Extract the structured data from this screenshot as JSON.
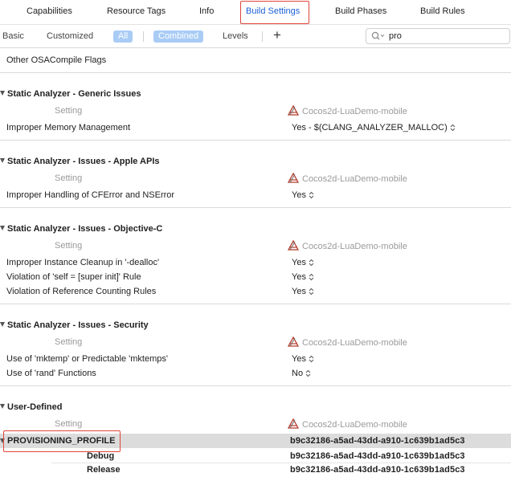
{
  "tabs": [
    {
      "label": "Capabilities"
    },
    {
      "label": "Resource Tags"
    },
    {
      "label": "Info"
    },
    {
      "label": "Build Settings"
    },
    {
      "label": "Build Phases"
    },
    {
      "label": "Build Rules"
    }
  ],
  "filter": {
    "basic": "Basic",
    "customized": "Customized",
    "all": "All",
    "combined": "Combined",
    "levels": "Levels",
    "add": "+"
  },
  "search": {
    "value": "pro"
  },
  "top_row": {
    "label": "Other OSACompile Flags"
  },
  "column": {
    "setting": "Setting",
    "target": "Cocos2d-LuaDemo-mobile"
  },
  "sections": {
    "generic": {
      "title": "Static Analyzer - Generic Issues",
      "rows": [
        {
          "label": "Improper Memory Management",
          "value": "Yes  -  $(CLANG_ANALYZER_MALLOC)"
        }
      ]
    },
    "apple": {
      "title": "Static Analyzer - Issues - Apple APIs",
      "rows": [
        {
          "label": "Improper Handling of CFError and NSError",
          "value": "Yes"
        }
      ]
    },
    "objc": {
      "title": "Static Analyzer - Issues - Objective-C",
      "rows": [
        {
          "label": "Improper Instance Cleanup in '-dealloc'",
          "value": "Yes"
        },
        {
          "label": "Violation of 'self = [super init]' Rule",
          "value": "Yes"
        },
        {
          "label": "Violation of Reference Counting Rules",
          "value": "Yes"
        }
      ]
    },
    "security": {
      "title": "Static Analyzer - Issues - Security",
      "rows": [
        {
          "label": "Use of 'mktemp' or Predictable 'mktemps'",
          "value": "Yes"
        },
        {
          "label": "Use of 'rand' Functions",
          "value": "No"
        }
      ]
    },
    "user": {
      "title": "User-Defined",
      "profile_label": "PROVISIONING_PROFILE",
      "profile_value": "b9c32186-a5ad-43dd-a910-1c639b1ad5c3",
      "debug_label": "Debug",
      "debug_value": "b9c32186-a5ad-43dd-a910-1c639b1ad5c3",
      "release_label": "Release",
      "release_value": "b9c32186-a5ad-43dd-a910-1c639b1ad5c3"
    }
  },
  "colors": {
    "accent": "#1a5fd8",
    "annotation": "#e0443a",
    "pill": "#a9ccf5"
  }
}
